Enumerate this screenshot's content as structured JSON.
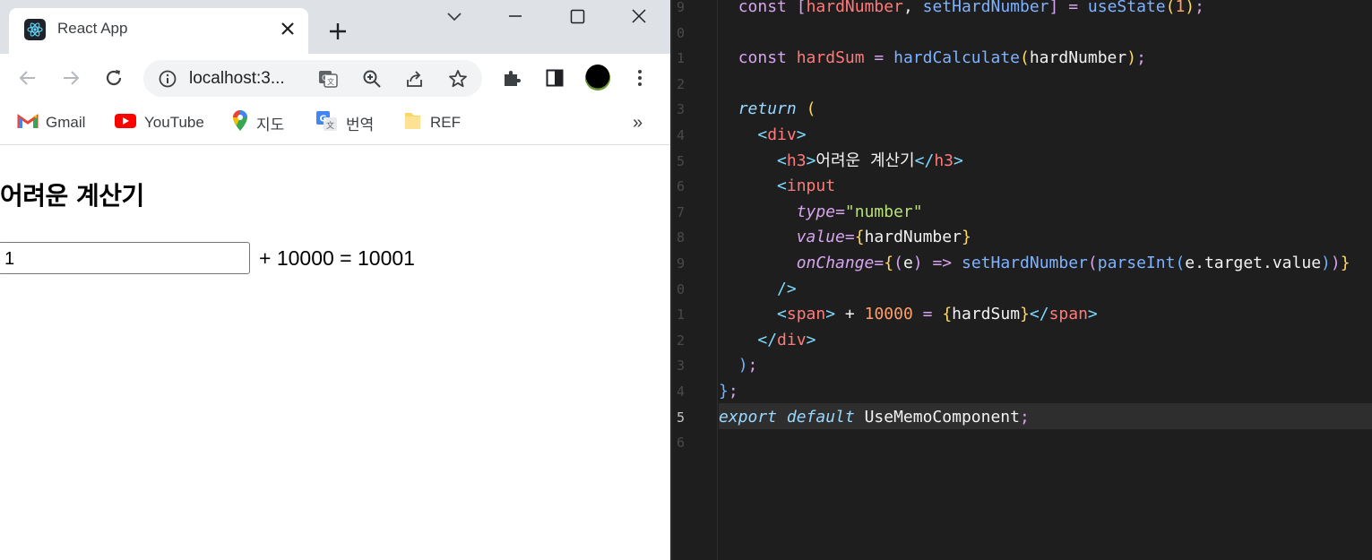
{
  "browser": {
    "tab_title": "React App",
    "url": "localhost:3...",
    "bookmarks": [
      {
        "label": "Gmail",
        "icon": "gmail-icon"
      },
      {
        "label": "YouTube",
        "icon": "youtube-icon"
      },
      {
        "label": "지도",
        "icon": "maps-icon"
      },
      {
        "label": "번역",
        "icon": "translate-icon"
      },
      {
        "label": "REF",
        "icon": "folder-icon"
      }
    ],
    "more_bookmarks": "»"
  },
  "page": {
    "heading": "어려운 계산기",
    "input_value": "1",
    "result_text": "+ 10000 = 10001"
  },
  "editor": {
    "line_numbers": [
      "9",
      "0",
      "1",
      "2",
      "3",
      "4",
      "5",
      "6",
      "7",
      "8",
      "9",
      "0",
      "1",
      "2",
      "3",
      "4",
      "5",
      "6"
    ],
    "active_line_number": "5",
    "lines": [
      "  const [hardNumber, setHardNumber] = useState(1);",
      "",
      "  const hardSum = hardCalculate(hardNumber);",
      "",
      "  return (",
      "    <div>",
      "      <h3>어려운 계산기</h3>",
      "      <input",
      "        type=\"number\"",
      "        value={hardNumber}",
      "        onChange={(e) => setHardNumber(parseInt(e.target.value))}",
      "      />",
      "      <span> + 10000 = {hardSum}</span>",
      "    </div>",
      "  );",
      "};",
      "export default UseMemoComponent;",
      ""
    ]
  },
  "colors": {
    "tabstrip_bg": "#dee1e6",
    "editor_bg": "#1e1e1e",
    "active_line_bg": "#2e2e2e"
  }
}
